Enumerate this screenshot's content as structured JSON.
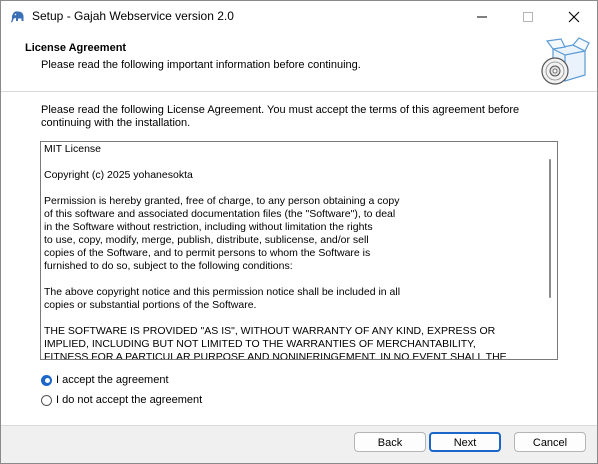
{
  "window": {
    "title": "Setup - Gajah Webservice version 2.0"
  },
  "header": {
    "title": "License Agreement",
    "subtitle": "Please read the following important information before continuing."
  },
  "body": {
    "intro": "Please read the following License Agreement. You must accept the terms of this agreement before continuing with the installation.",
    "license_text": "MIT License\n\nCopyright (c) 2025 yohanesokta\n\nPermission is hereby granted, free of charge, to any person obtaining a copy\nof this software and associated documentation files (the \"Software\"), to deal\nin the Software without restriction, including without limitation the rights\nto use, copy, modify, merge, publish, distribute, sublicense, and/or sell\ncopies of the Software, and to permit persons to whom the Software is\nfurnished to do so, subject to the following conditions:\n\nThe above copyright notice and this permission notice shall be included in all\ncopies or substantial portions of the Software.\n\nTHE SOFTWARE IS PROVIDED \"AS IS\", WITHOUT WARRANTY OF ANY KIND, EXPRESS OR\nIMPLIED, INCLUDING BUT NOT LIMITED TO THE WARRANTIES OF MERCHANTABILITY,\nFITNESS FOR A PARTICULAR PURPOSE AND NONINFRINGEMENT. IN NO EVENT SHALL THE",
    "options": [
      {
        "label": "I accept the agreement",
        "checked": true
      },
      {
        "label": "I do not accept the agreement",
        "checked": false
      }
    ]
  },
  "footer": {
    "back_label": "Back",
    "next_label": "Next",
    "cancel_label": "Cancel"
  },
  "icons": {
    "app": "elephant-icon",
    "header_graphic": "software-box-cd-icon"
  },
  "colors": {
    "accent": "#1b66c9"
  }
}
